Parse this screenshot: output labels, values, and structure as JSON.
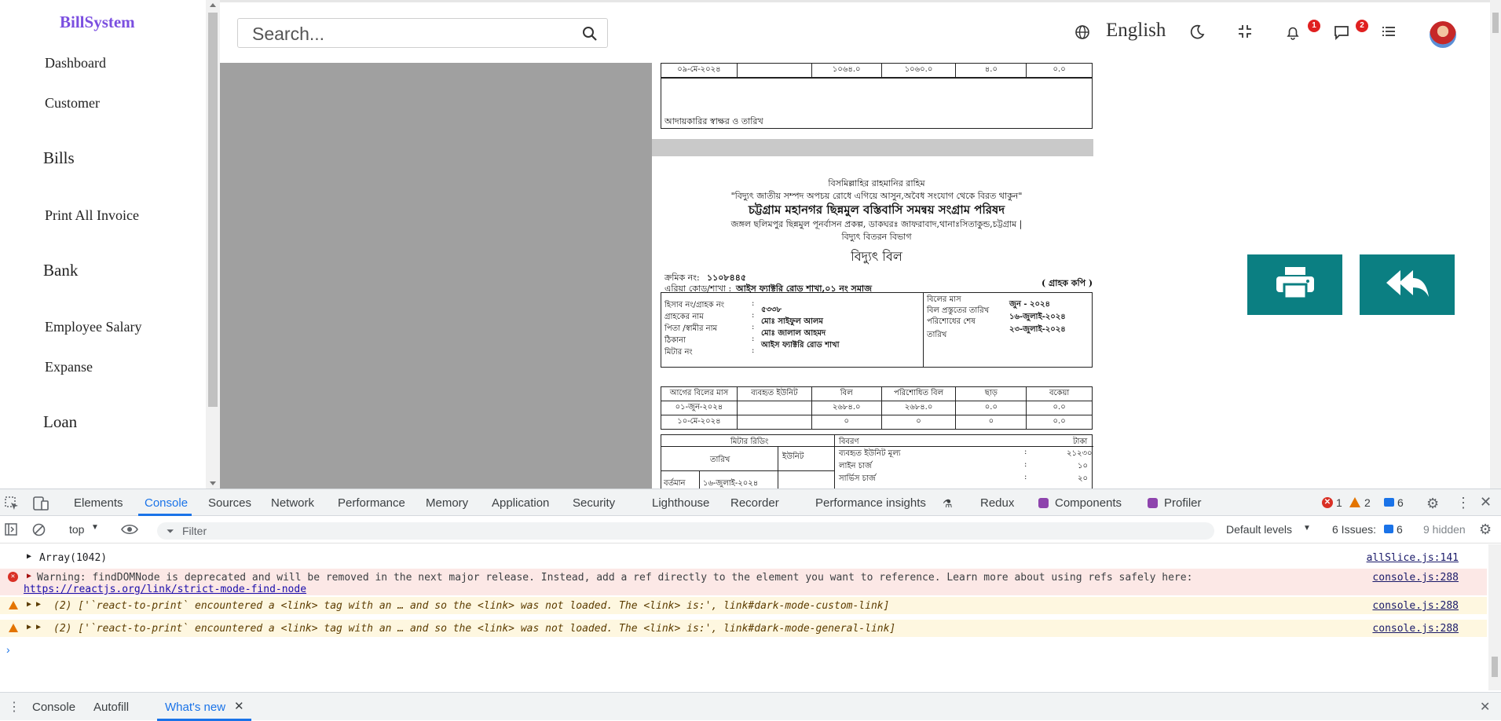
{
  "app": {
    "brand": "BillSystem"
  },
  "sidebar": {
    "items": [
      {
        "label": "Dashboard"
      },
      {
        "label": "Customer"
      },
      {
        "label": "Bills"
      },
      {
        "label": "Print All Invoice"
      },
      {
        "label": "Bank"
      },
      {
        "label": "Employee Salary"
      },
      {
        "label": "Expanse"
      },
      {
        "label": "Loan"
      }
    ]
  },
  "header": {
    "search_placeholder": "Search...",
    "language": "English",
    "notification_count": "1",
    "message_count": "2",
    "icons": [
      "globe-icon",
      "moon-icon",
      "compress-icon",
      "bell-icon",
      "chat-icon",
      "list-icon"
    ]
  },
  "invoice": {
    "top_row": [
      "০৯-মে-২০২৪",
      "",
      "১০৬৪.০",
      "১০৬০.০",
      "৪.০",
      "০.০"
    ],
    "signature_label": "আদায়কারির স্বাক্ষর ও তারিখ",
    "bismillah": "বিসমিল্লাহির রাহমানির রাহিম",
    "slogan": "\"বিদ্যুৎ জাতীয় সম্পদ অপচয় রোধে এগিয়ে আসুন,অবৈধ সংযোগ থেকে বিরত থাকুন\"",
    "org_name": "চট্টগ্রাম মহানগর ছিন্নমুল বস্তিবাসি সমন্বয় সংগ্রাম পরিষদ",
    "address": "জঙ্গল ছলিমপুর ছিন্নমুল পূনর্বাসন প্রকল্প, ডাকঘরঃ জাফরাবাদ,থানাঃসিতাকুন্ড,চট্টগ্রাম |",
    "department": "বিদ্যুৎ বিতরন বিভাগ",
    "doc_title": "বিদ্যুৎ বিল",
    "serial_label": "ক্রমিক নং:",
    "serial_value": "১১০৮৪৪৫",
    "area_label": "এরিয়া কোড/শাখা :",
    "area_value": "আইস ফ্যাক্টরি রোড শাখা,০১ নং সমাজ",
    "copy_label": "( গ্রাহক কপি )",
    "customer_labels": [
      "হিসাব নং/গ্রাহক নং",
      "গ্রাহকের নাম",
      "পিতা /স্বামীর নাম",
      "ঠিকানা",
      "মিটার নং"
    ],
    "customer_values": [
      "৫৩৩৮",
      "মোঃ সাইফুল আলম",
      "মোঃ জালাল আহমদ",
      "আইস ফ্যাক্টরি রোড শাখা",
      ""
    ],
    "bill_month_label": "বিলের মাস",
    "bill_month_value": "জুন - ২০২৪",
    "prepared_label": "বিল প্রস্তুতের তারিখ",
    "prepared_value": "১৬-জুলাই-২০২৪",
    "due_label": "পরিশোধের শেষ তারিখ",
    "due_value": "২৩-জুলাই-২০২৪",
    "history_headers": [
      "আগের বিলের মাস",
      "ব্যবহৃত ইউনিট",
      "বিল",
      "পরিশোধিত বিল",
      "ছাড়",
      "বকেয়া"
    ],
    "history_rows": [
      [
        "০১-জুন-২০২৪",
        "",
        "২৬৮৪.০",
        "২৬৮৪.০",
        "০.০",
        "০.০"
      ],
      [
        "১০-মে-২০২৪",
        "",
        "০",
        "০",
        "০",
        "০.০"
      ]
    ],
    "meter_reading_label": "মিটার রিডিং",
    "date_label": "তারিখ",
    "unit_label": "ইউনিট",
    "details_label": "বিবরণ",
    "taka_label": "টাকা",
    "current_label": "বর্তমান",
    "current_date": "১৬-জুলাই-২০২৪",
    "charges": [
      {
        "label": "ব্যবহৃত ইউনিট মূল্য",
        "value": "২১২৩০"
      },
      {
        "label": "লাইন চার্জ",
        "value": "১০"
      },
      {
        "label": "সার্ভিস চার্জ",
        "value": "২০"
      }
    ]
  },
  "actions": {
    "print": "printer-icon",
    "back": "reply-all-icon"
  },
  "devtools": {
    "tabs": [
      "Elements",
      "Console",
      "Sources",
      "Network",
      "Performance",
      "Memory",
      "Application",
      "Security",
      "Lighthouse",
      "Recorder",
      "Performance insights",
      "Redux",
      "Components",
      "Profiler"
    ],
    "active_tab": "Console",
    "error_count": "1",
    "warning_count": "2",
    "info_count": "6",
    "context": "top",
    "filter_placeholder": "Filter",
    "levels": "Default levels",
    "issues_label": "6 Issues:",
    "issues_count": "6",
    "hidden": "9 hidden",
    "logs": [
      {
        "type": "log",
        "text": "Array(1042)",
        "source": "allSlice.js:141"
      },
      {
        "type": "error",
        "text": "Warning: findDOMNode is deprecated and will be removed in the next major release. Instead, add a ref directly to the element you want to reference. Learn more about using refs safely here:",
        "link": "https://reactjs.org/link/strict-mode-find-node",
        "source": "console.js:288"
      },
      {
        "type": "warn",
        "text": "(2) ['`react-to-print` encountered a <link> tag with an … and so the <link> was not loaded. The <link> is:', link#dark-mode-custom-link]",
        "source": "console.js:288"
      },
      {
        "type": "warn",
        "text": "(2) ['`react-to-print` encountered a <link> tag with an … and so the <link> was not loaded. The <link> is:', link#dark-mode-general-link]",
        "source": "console.js:288"
      }
    ],
    "drawer_tabs": [
      "Console",
      "Autofill",
      "What's new"
    ],
    "drawer_active": "What's new"
  }
}
